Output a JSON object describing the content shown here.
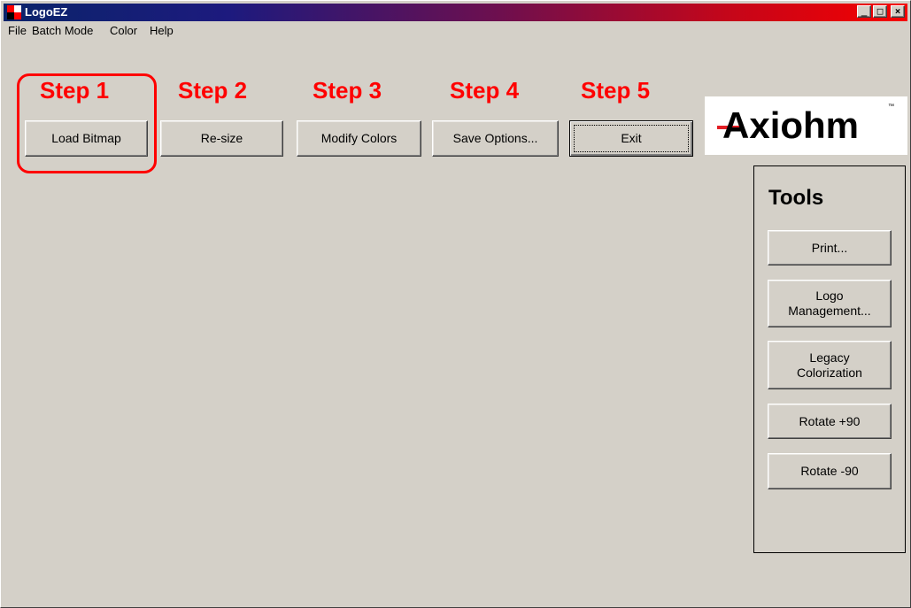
{
  "window": {
    "title": "LogoEZ",
    "controls": {
      "minimize": "_",
      "maximize": "□",
      "close": "×"
    }
  },
  "menu": [
    "File",
    "Batch Mode",
    "Color",
    "Help"
  ],
  "steps": [
    "Step 1",
    "Step 2",
    "Step 3",
    "Step 4",
    "Step 5"
  ],
  "step_buttons": [
    "Load Bitmap",
    "Re-size",
    "Modify Colors",
    "Save Options...",
    "Exit"
  ],
  "logo": {
    "text": "Axiohm",
    "tm": "™"
  },
  "tools": {
    "title": "Tools",
    "buttons": [
      "Print...",
      "Logo\nManagement...",
      "Legacy\nColorization",
      "Rotate +90",
      "Rotate -90"
    ]
  },
  "colors": {
    "accent_red": "#ff0000",
    "face": "#d4d0c8",
    "title_start": "#0a246a",
    "title_end": "#f60000"
  },
  "icons": {
    "app": "logoez-app-icon"
  }
}
